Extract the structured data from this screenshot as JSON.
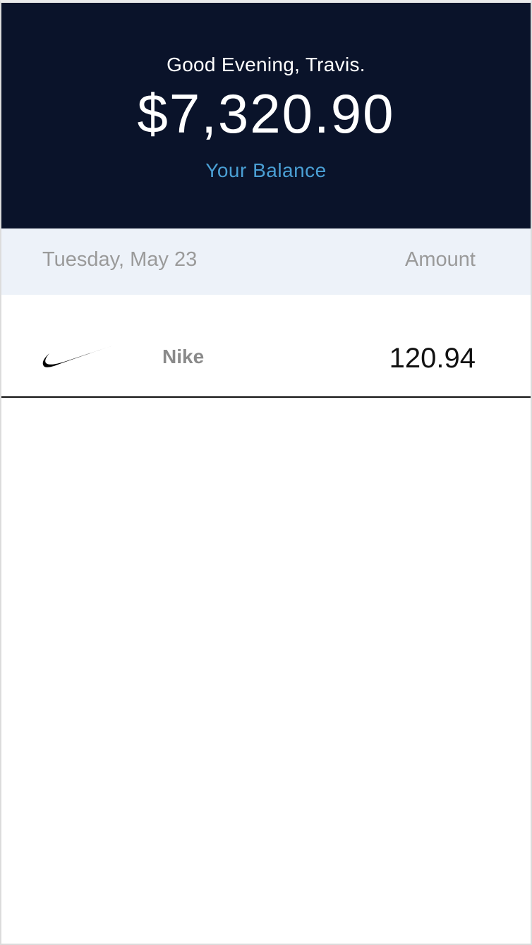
{
  "header": {
    "greeting": "Good Evening, Travis.",
    "balance": "$7,320.90",
    "balance_label": "Your Balance",
    "background_color": "#0a132a",
    "label_color": "#4a9fd4"
  },
  "transactions_section": {
    "date": "Tuesday, May 23",
    "amount_header": "Amount",
    "background_color": "#edf2f9"
  },
  "transactions": [
    {
      "logo_icon": "nike-swoosh-icon",
      "merchant": "Nike",
      "amount": "120.94"
    }
  ]
}
